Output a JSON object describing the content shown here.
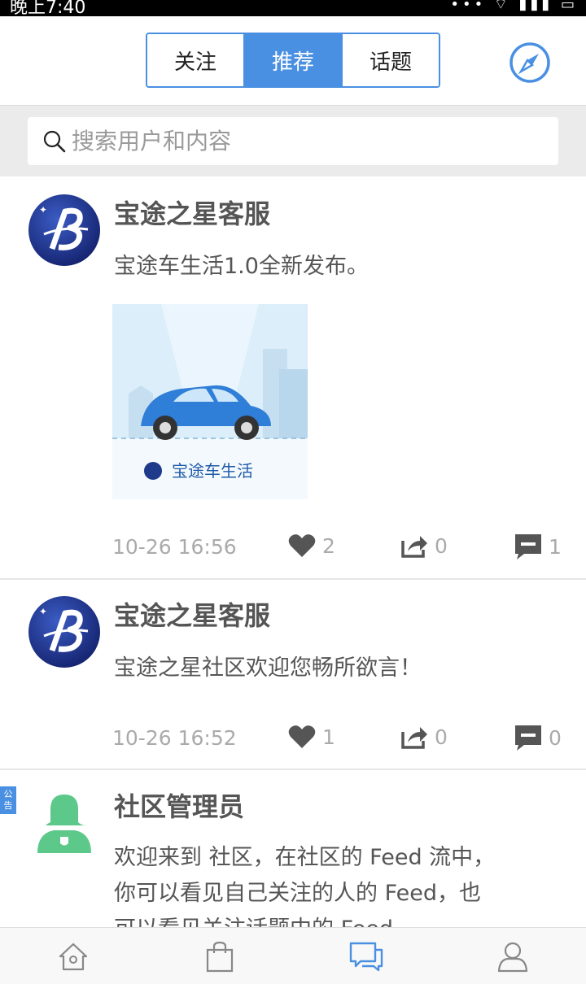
{
  "status_bar": {
    "time": "晚上7:40",
    "icons": "••• ⌔ ▮▮▮ ▭"
  },
  "header": {
    "tabs": [
      {
        "label": "关注",
        "active": false
      },
      {
        "label": "推荐",
        "active": true
      },
      {
        "label": "话题",
        "active": false
      }
    ],
    "right_icon": "compass-icon"
  },
  "search": {
    "placeholder": "搜索用户和内容",
    "value": ""
  },
  "posts": [
    {
      "author": "宝途之星客服",
      "content": "宝途车生活1.0全新发布。",
      "image_caption": "宝途车生活",
      "time": "10-26 16:56",
      "likes": "2",
      "shares": "0",
      "comments": "1"
    },
    {
      "author": "宝途之星客服",
      "content": "宝途之星社区欢迎您畅所欲言！",
      "time": "10-26 16:52",
      "likes": "1",
      "shares": "0",
      "comments": "0"
    },
    {
      "badge": "公告",
      "author": "社区管理员",
      "content_lines": [
        "欢迎来到 社区，在社区的 Feed 流中，",
        "你可以看见自己关注的人的 Feed，也",
        "可以看见关注话题中的 Feed。"
      ]
    }
  ],
  "bottom_nav": [
    {
      "icon": "home-icon",
      "active": false
    },
    {
      "icon": "shopping-bag-icon",
      "active": false
    },
    {
      "icon": "chat-icon",
      "active": true
    },
    {
      "icon": "user-icon",
      "active": false
    }
  ],
  "colors": {
    "accent": "#4a90e2",
    "avatar_blue": "#1e3a8a",
    "admin_green": "#5cc98a"
  }
}
